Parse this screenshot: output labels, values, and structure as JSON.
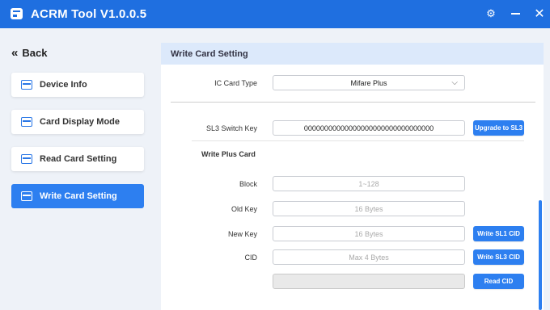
{
  "app": {
    "title": "ACRM Tool V1.0.0.5"
  },
  "titlebar": {
    "icons": [
      "settings-gear-icon",
      "minimize-icon",
      "close-icon"
    ]
  },
  "sidebar": {
    "back_label": "Back",
    "items": [
      {
        "label": "Device Info",
        "icon": "device-info-icon"
      },
      {
        "label": "Card Display Mode",
        "icon": "card-display-icon"
      },
      {
        "label": "Read Card Setting",
        "icon": "read-card-icon"
      },
      {
        "label": "Write Card Setting",
        "icon": "write-card-icon",
        "active": true
      }
    ]
  },
  "panel": {
    "title": "Write Card Setting",
    "ic_card_type": {
      "label": "IC Card Type",
      "value": "Mifare Plus"
    },
    "sl3_switch_key": {
      "label": "SL3 Switch Key",
      "value": "00000000000000000000000000000000",
      "button": "Upgrade to SL3"
    },
    "write_plus_card": {
      "title": "Write Plus Card",
      "block": {
        "label": "Block",
        "placeholder": "1~128"
      },
      "old_key": {
        "label": "Old Key",
        "placeholder": "16 Bytes"
      },
      "new_key": {
        "label": "New Key",
        "placeholder": "16 Bytes",
        "button": "Write SL1 CID"
      },
      "cid": {
        "label": "CID",
        "placeholder": "Max 4 Bytes",
        "button": "Write SL3 CID"
      },
      "read_cid": {
        "value": "",
        "button": "Read CID"
      }
    }
  },
  "colors": {
    "primary": "#2d7ff0",
    "titlebar": "#1f6fe0",
    "panel_header": "#dce9fb",
    "background": "#eef2f8"
  }
}
